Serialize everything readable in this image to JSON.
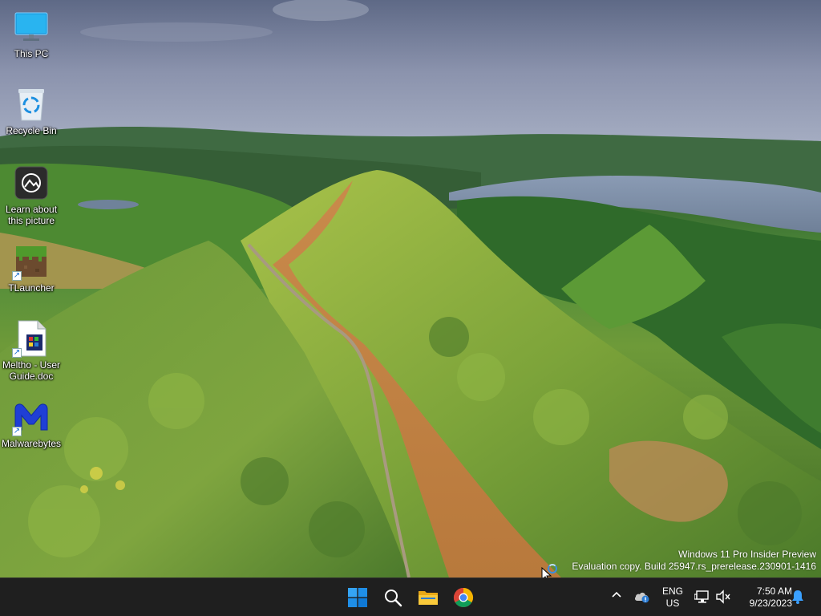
{
  "desktop": {
    "icons": [
      {
        "name": "this-pc",
        "label": "This PC",
        "icon": "monitor-icon",
        "shortcut": false
      },
      {
        "name": "recycle-bin",
        "label": "Recycle Bin",
        "icon": "recycle-bin-icon",
        "shortcut": false
      },
      {
        "name": "learn-about-picture",
        "label": "Learn about\nthis picture",
        "icon": "camera-icon",
        "shortcut": false
      },
      {
        "name": "tlauncher",
        "label": "TLauncher",
        "icon": "grass-block-icon",
        "shortcut": true
      },
      {
        "name": "meltho-user-guide",
        "label": "Meltho - User\nGuide.doc",
        "icon": "document-icon",
        "shortcut": true
      },
      {
        "name": "malwarebytes",
        "label": "Malwarebytes",
        "icon": "malwarebytes-icon",
        "shortcut": true
      }
    ],
    "watermark": {
      "line1": "Windows 11 Pro Insider Preview",
      "line2": "Evaluation copy. Build 25947.rs_prerelease.230901-1416"
    }
  },
  "taskbar": {
    "apps": [
      {
        "name": "start",
        "icon": "windows-logo-icon"
      },
      {
        "name": "search",
        "icon": "search-icon"
      },
      {
        "name": "file-explorer",
        "icon": "folder-icon"
      },
      {
        "name": "chrome",
        "icon": "chrome-icon"
      }
    ],
    "tray": {
      "lang_top": "ENG",
      "lang_bottom": "US",
      "time": "7:50 AM",
      "date": "9/23/2023"
    }
  },
  "colors": {
    "taskbar_bg": "#1f1f1f",
    "accent": "#0078d4",
    "bell": "#3aa0ff"
  }
}
